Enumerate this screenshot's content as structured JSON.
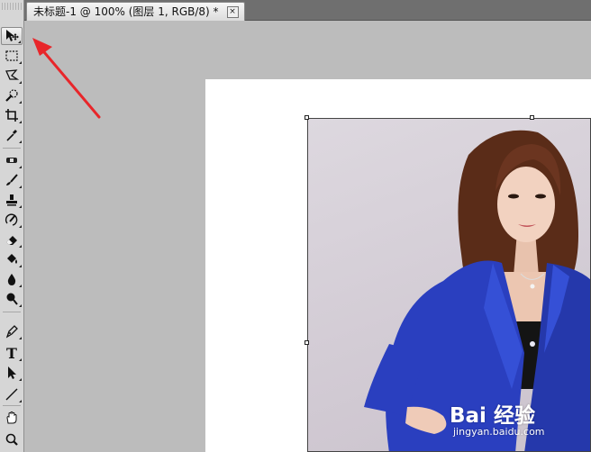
{
  "document_tab": {
    "title": "未标题-1 @ 100% (图层 1, RGB/8) *",
    "close_glyph": "×"
  },
  "tools": [
    {
      "name": "move-tool",
      "icon": "move-icon",
      "selected": true
    },
    {
      "name": "marquee-tool",
      "icon": "rect-marquee-icon"
    },
    {
      "name": "lasso-tool",
      "icon": "polygon-lasso-icon"
    },
    {
      "name": "quick-select-tool",
      "icon": "quick-select-icon"
    },
    {
      "name": "crop-tool",
      "icon": "crop-icon"
    },
    {
      "name": "eyedropper-tool",
      "icon": "eyedropper-icon"
    },
    {
      "name": "healing-brush-tool",
      "icon": "bandage-icon"
    },
    {
      "name": "brush-tool",
      "icon": "brush-icon"
    },
    {
      "name": "clone-stamp-tool",
      "icon": "stamp-icon"
    },
    {
      "name": "history-brush-tool",
      "icon": "history-brush-icon"
    },
    {
      "name": "eraser-tool",
      "icon": "eraser-icon"
    },
    {
      "name": "paint-bucket-tool",
      "icon": "bucket-icon"
    },
    {
      "name": "blur-tool",
      "icon": "drop-icon"
    },
    {
      "name": "dodge-tool",
      "icon": "dodge-icon"
    },
    {
      "name": "pen-tool",
      "icon": "pen-icon"
    },
    {
      "name": "type-tool",
      "icon": "type-icon",
      "label": "T"
    },
    {
      "name": "path-select-tool",
      "icon": "arrow-icon"
    },
    {
      "name": "line-tool",
      "icon": "line-icon"
    },
    {
      "name": "hand-tool",
      "icon": "hand-icon"
    },
    {
      "name": "zoom-tool",
      "icon": "magnifier-icon"
    }
  ],
  "watermark": {
    "main": "Bai 经验",
    "sub": "jingyan.baidu.com"
  },
  "colors": {
    "annotation_arrow": "#e8262a",
    "jacket_blue": "#2a3fbf",
    "workspace": "#bcbcbc"
  }
}
